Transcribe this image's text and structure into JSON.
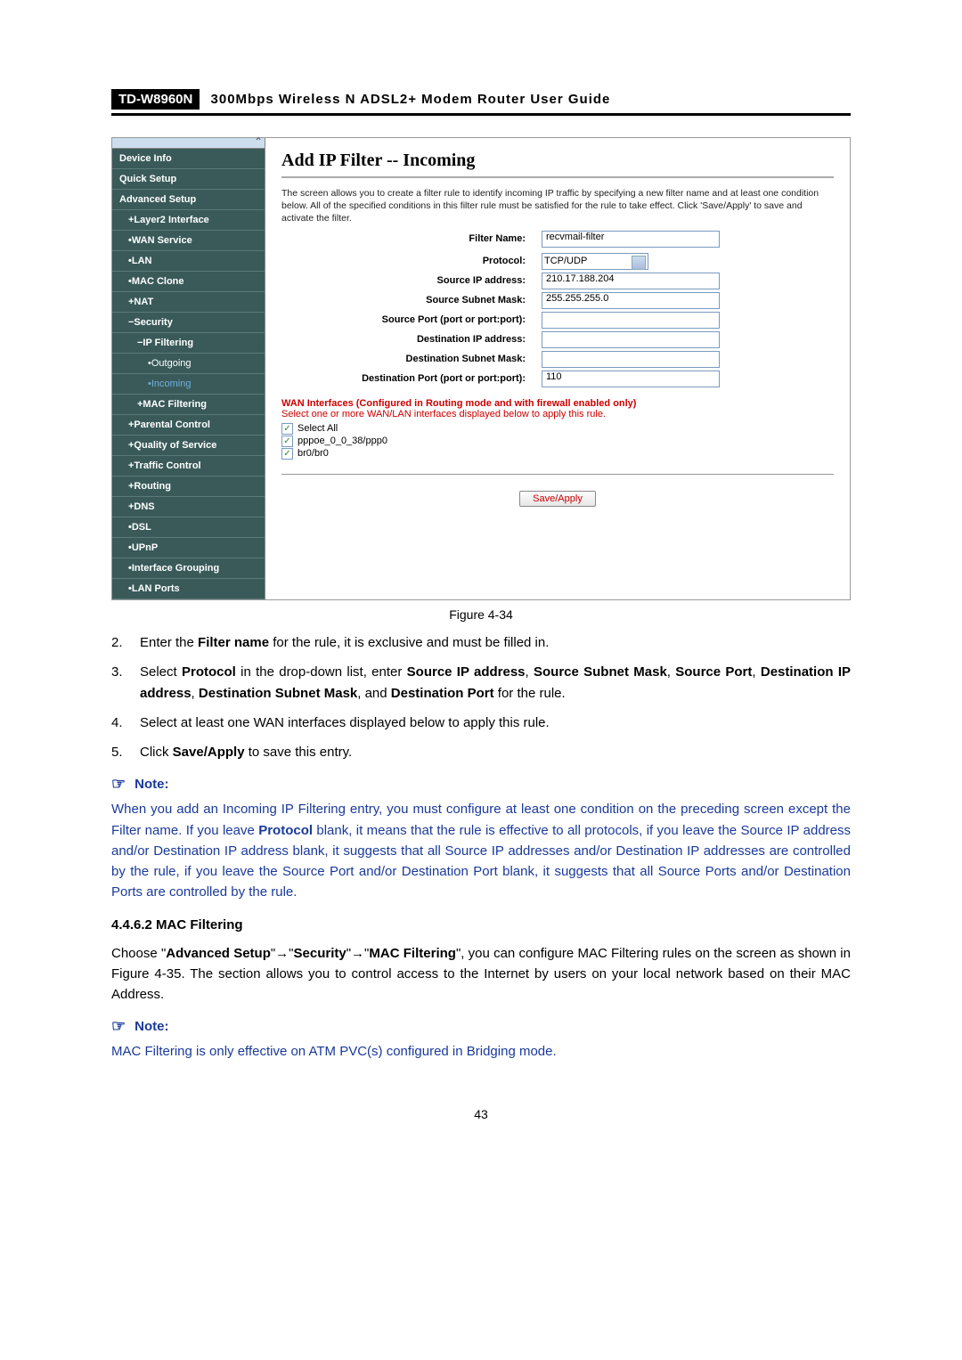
{
  "header": {
    "model": "TD-W8960N",
    "title": "300Mbps  Wireless  N  ADSL2+  Modem  Router  User  Guide"
  },
  "nav": {
    "items": [
      "Device Info",
      "Quick Setup",
      "Advanced Setup",
      "+Layer2 Interface",
      "•WAN Service",
      "•LAN",
      "•MAC Clone",
      "+NAT",
      "−Security",
      "−IP Filtering",
      "•Outgoing",
      "•Incoming",
      "+MAC Filtering",
      "+Parental Control",
      "+Quality of Service",
      "+Traffic Control",
      "+Routing",
      "+DNS",
      "•DSL",
      "•UPnP",
      "•Interface Grouping",
      "•LAN Ports"
    ]
  },
  "panel": {
    "heading": "Add IP Filter -- Incoming",
    "blurb": "The screen allows you to create a filter rule to identify incoming IP traffic by specifying a new filter name and at least one condition below. All of the specified conditions in this filter rule must be satisfied for the rule to take effect. Click 'Save/Apply' to save and activate the filter.",
    "labels": {
      "filter_name": "Filter Name:",
      "protocol": "Protocol:",
      "src_ip": "Source IP address:",
      "src_mask": "Source Subnet Mask:",
      "src_port": "Source Port (port or port:port):",
      "dst_ip": "Destination IP address:",
      "dst_mask": "Destination Subnet Mask:",
      "dst_port": "Destination Port (port or port:port):"
    },
    "values": {
      "filter_name": "recvmail-filter",
      "protocol": "TCP/UDP",
      "src_ip": "210.17.188.204",
      "src_mask": "255.255.255.0",
      "src_port": "",
      "dst_ip": "",
      "dst_mask": "",
      "dst_port": "110"
    },
    "wan_head": "WAN Interfaces (Configured in Routing mode and with firewall enabled only)",
    "wan_sub": "Select one or more WAN/LAN interfaces displayed below to apply this rule.",
    "checks": [
      "Select All",
      "pppoe_0_0_38/ppp0",
      "br0/br0"
    ],
    "save": "Save/Apply"
  },
  "caption": "Figure 4-34",
  "steps": {
    "s2": {
      "n": "2.",
      "a": "Enter the ",
      "b": "Filter name",
      "c": " for the rule, it is exclusive and must be filled in."
    },
    "s3": {
      "n": "3.",
      "a": "Select ",
      "b": "Protocol",
      "c": " in the drop-down list, enter ",
      "d": "Source IP address",
      "e": ", ",
      "f": "Source Subnet Mask",
      "g": ", ",
      "h": "Source Port",
      "i": ", ",
      "j": "Destination IP address",
      "k": ", ",
      "l": "Destination Subnet Mask",
      "m": ", and ",
      "nn": "Destination Port",
      "o": " for the rule."
    },
    "s4": {
      "n": "4.",
      "t": "Select at least one WAN interfaces displayed below to apply this rule."
    },
    "s5": {
      "n": "5.",
      "a": "Click ",
      "b": "Save/Apply",
      "c": " to save this entry."
    }
  },
  "note1": {
    "label": "Note:",
    "a": "When you add an Incoming IP Filtering entry, you must configure at least one condition on the preceding screen except the Filter name. If you leave ",
    "b": "Protocol",
    "c": " blank, it means that the rule is effective to all protocols, if you leave the Source IP address and/or Destination IP address blank, it suggests that all Source IP addresses and/or Destination IP addresses are controlled by the rule, if you leave the Source Port and/or Destination Port blank, it suggests that all Source Ports and/or Destination Ports are controlled by the rule."
  },
  "section": {
    "head": "4.4.6.2   MAC Filtering",
    "p_a": "Choose \"",
    "p_b": "Advanced Setup",
    "p_c": "\"→\"",
    "p_d": "Security",
    "p_e": "\"→\"",
    "p_f": "MAC Filtering",
    "p_g": "\", you can configure MAC Filtering rules on the screen as shown in Figure 4-35. The section allows you to control access to the Internet by users on your local network based on their MAC Address."
  },
  "note2": {
    "label": "Note:",
    "body": "MAC Filtering is only effective on ATM PVC(s) configured in Bridging mode."
  },
  "pagenum": "43"
}
